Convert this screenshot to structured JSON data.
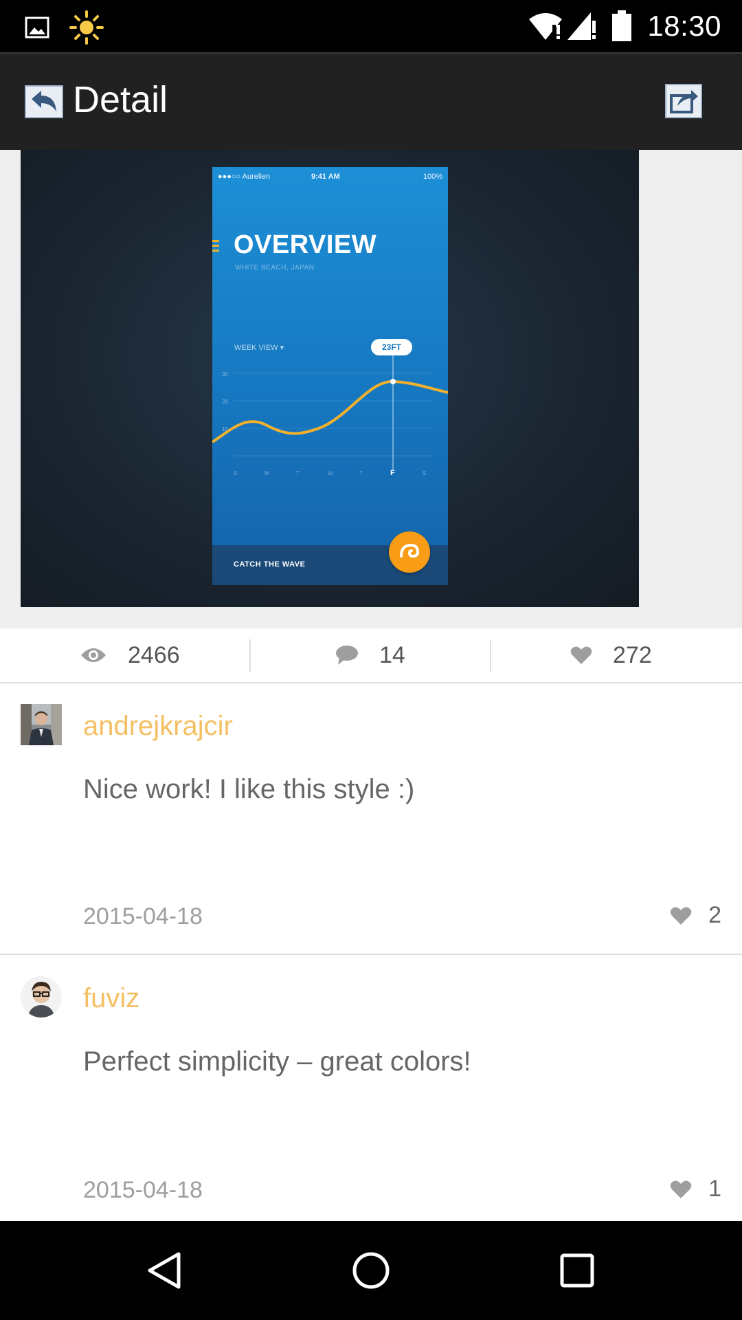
{
  "status_bar": {
    "time": "18:30",
    "icons": [
      "image-icon",
      "brightness-icon",
      "wifi-alert-icon",
      "signal-alert-icon",
      "battery-icon"
    ]
  },
  "toolbar": {
    "title": "Detail",
    "back_icon": "back-arrow-icon",
    "share_icon": "share-icon"
  },
  "shot": {
    "phone_status_left": "●●●○○ Aurelien",
    "phone_status_time": "9:41 AM",
    "phone_status_battery": "100%",
    "title": "OVERVIEW",
    "subtitle": "WHITE BEACH, JAPAN",
    "week_label": "WEEK VIEW ▾",
    "pill": "23FT",
    "y_ticks": [
      "30",
      "20",
      "10"
    ],
    "days": [
      "S",
      "M",
      "T",
      "W",
      "T",
      "F",
      "S"
    ],
    "footer_text": "CATCH THE WAVE",
    "accent_color": "#f99c16",
    "chart_line_color": "#f3b12d"
  },
  "stats": {
    "views": "2466",
    "comments": "14",
    "likes": "272"
  },
  "comments": [
    {
      "user": "andrejkrajcir",
      "text": "Nice work! I like this style :)",
      "date": "2015-04-18",
      "likes": "2"
    },
    {
      "user": "fuviz",
      "text": "Perfect simplicity – great colors!",
      "date": "2015-04-18",
      "likes": "1"
    }
  ],
  "colors": {
    "username": "#f5c064",
    "toolbar_bg": "#212121",
    "body_text": "#666666",
    "date_text": "#9e9e9e"
  }
}
